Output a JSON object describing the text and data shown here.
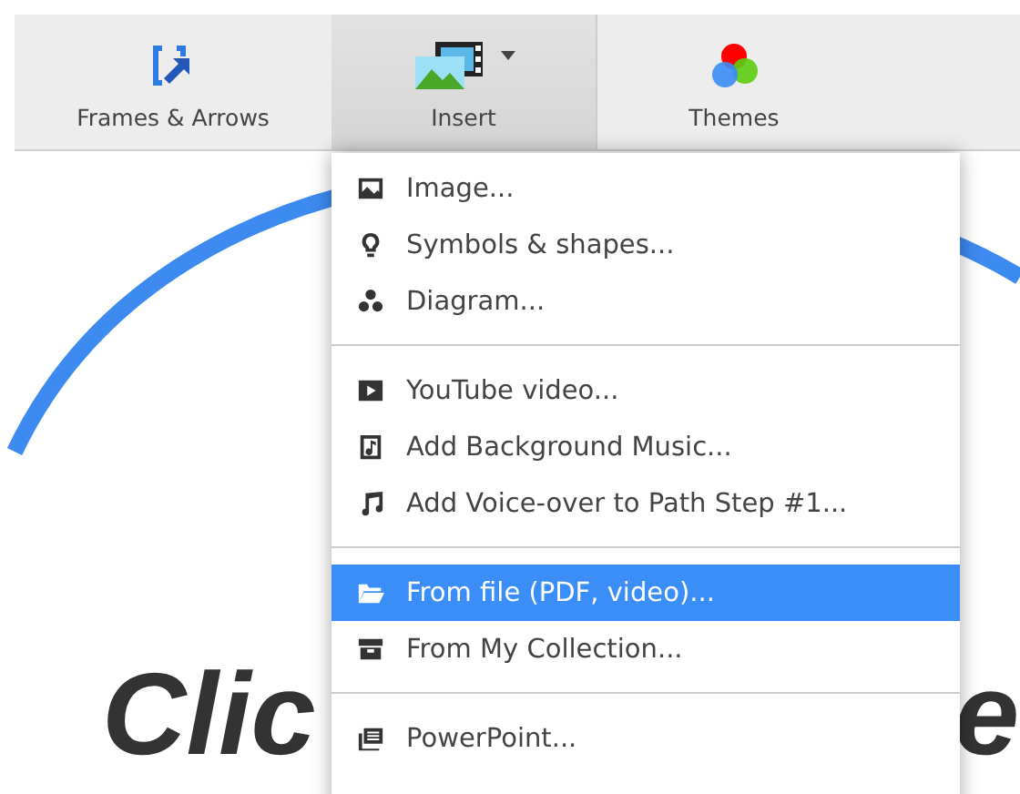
{
  "toolbar": {
    "buttons": [
      {
        "label": "Frames & Arrows",
        "selected": false,
        "dropdown": false
      },
      {
        "label": "Insert",
        "selected": true,
        "dropdown": true
      },
      {
        "label": "Themes",
        "selected": false,
        "dropdown": false
      }
    ]
  },
  "canvas": {
    "title_parts": [
      "Clic",
      "e"
    ]
  },
  "insert_menu": {
    "sections": [
      {
        "items": [
          {
            "label": "Image...",
            "selected": false
          },
          {
            "label": "Symbols & shapes...",
            "selected": false
          },
          {
            "label": "Diagram...",
            "selected": false
          }
        ]
      },
      {
        "items": [
          {
            "label": "YouTube video...",
            "selected": false
          },
          {
            "label": "Add Background Music...",
            "selected": false
          },
          {
            "label": "Add Voice-over to Path Step #1...",
            "selected": false
          }
        ]
      },
      {
        "items": [
          {
            "label": "From file (PDF, video)...",
            "selected": true
          },
          {
            "label": "From My Collection...",
            "selected": false
          }
        ]
      },
      {
        "items": [
          {
            "label": "PowerPoint...",
            "selected": false
          }
        ]
      }
    ]
  }
}
